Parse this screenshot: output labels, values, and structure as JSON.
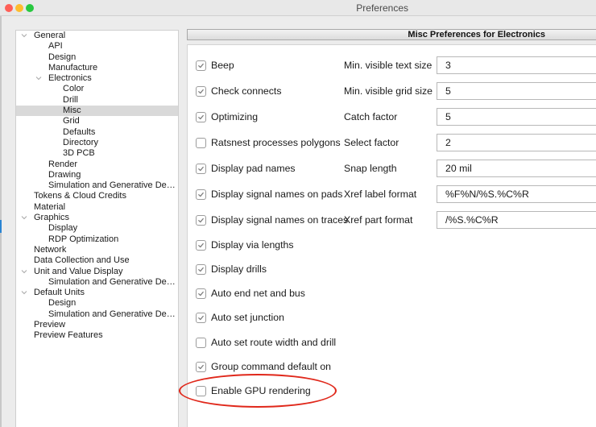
{
  "window": {
    "title": "Preferences"
  },
  "tree": {
    "items": [
      {
        "label": "General",
        "level": 0,
        "expanded": true,
        "selected": false
      },
      {
        "label": "API",
        "level": 1,
        "expanded": null,
        "selected": false
      },
      {
        "label": "Design",
        "level": 1,
        "expanded": null,
        "selected": false
      },
      {
        "label": "Manufacture",
        "level": 1,
        "expanded": null,
        "selected": false
      },
      {
        "label": "Electronics",
        "level": 1,
        "expanded": true,
        "selected": false
      },
      {
        "label": "Color",
        "level": 2,
        "expanded": null,
        "selected": false
      },
      {
        "label": "Drill",
        "level": 2,
        "expanded": null,
        "selected": false
      },
      {
        "label": "Misc",
        "level": 2,
        "expanded": null,
        "selected": true
      },
      {
        "label": "Grid",
        "level": 2,
        "expanded": null,
        "selected": false
      },
      {
        "label": "Defaults",
        "level": 2,
        "expanded": null,
        "selected": false
      },
      {
        "label": "Directory",
        "level": 2,
        "expanded": null,
        "selected": false
      },
      {
        "label": "3D PCB",
        "level": 2,
        "expanded": null,
        "selected": false
      },
      {
        "label": "Render",
        "level": 1,
        "expanded": null,
        "selected": false
      },
      {
        "label": "Drawing",
        "level": 1,
        "expanded": null,
        "selected": false
      },
      {
        "label": "Simulation and Generative Desi...",
        "level": 1,
        "expanded": null,
        "selected": false
      },
      {
        "label": "Tokens & Cloud Credits",
        "level": 0,
        "expanded": null,
        "selected": false
      },
      {
        "label": "Material",
        "level": 0,
        "expanded": null,
        "selected": false
      },
      {
        "label": "Graphics",
        "level": 0,
        "expanded": true,
        "selected": false
      },
      {
        "label": "Display",
        "level": 1,
        "expanded": null,
        "selected": false
      },
      {
        "label": "RDP Optimization",
        "level": 1,
        "expanded": null,
        "selected": false
      },
      {
        "label": "Network",
        "level": 0,
        "expanded": null,
        "selected": false
      },
      {
        "label": "Data Collection and Use",
        "level": 0,
        "expanded": null,
        "selected": false
      },
      {
        "label": "Unit and Value Display",
        "level": 0,
        "expanded": true,
        "selected": false
      },
      {
        "label": "Simulation and Generative Desi...",
        "level": 1,
        "expanded": null,
        "selected": false
      },
      {
        "label": "Default Units",
        "level": 0,
        "expanded": true,
        "selected": false
      },
      {
        "label": "Design",
        "level": 1,
        "expanded": null,
        "selected": false
      },
      {
        "label": "Simulation and Generative Desi...",
        "level": 1,
        "expanded": null,
        "selected": false
      },
      {
        "label": "Preview",
        "level": 0,
        "expanded": null,
        "selected": false
      },
      {
        "label": "Preview Features",
        "level": 0,
        "expanded": null,
        "selected": false
      }
    ]
  },
  "panel": {
    "title": "Misc Preferences for Electronics",
    "checkboxes": [
      {
        "label": "Beep",
        "checked": true
      },
      {
        "label": "Check connects",
        "checked": true
      },
      {
        "label": "Optimizing",
        "checked": true
      },
      {
        "label": "Ratsnest processes polygons",
        "checked": false
      },
      {
        "label": "Display pad names",
        "checked": true
      },
      {
        "label": "Display signal names on pads",
        "checked": true
      },
      {
        "label": "Display signal names on traces",
        "checked": true
      },
      {
        "label": "Display via lengths",
        "checked": true
      },
      {
        "label": "Display drills",
        "checked": true
      },
      {
        "label": "Auto end net and bus",
        "checked": true
      },
      {
        "label": "Auto set junction",
        "checked": true
      },
      {
        "label": "Auto set route width and drill",
        "checked": false
      },
      {
        "label": "Group command default on",
        "checked": true
      },
      {
        "label": "Enable GPU rendering",
        "checked": false
      }
    ],
    "fields": [
      {
        "label": "Min. visible text size",
        "value": "3"
      },
      {
        "label": "Min. visible grid size",
        "value": "5"
      },
      {
        "label": "Catch factor",
        "value": "5"
      },
      {
        "label": "Select factor",
        "value": "2"
      },
      {
        "label": "Snap length",
        "value": "20 mil"
      },
      {
        "label": "Xref label format",
        "value": "%F%N/%S.%C%R"
      },
      {
        "label": "Xref part format",
        "value": "/%S.%C%R"
      }
    ]
  },
  "annotation": {
    "highlighted_item": "Enable GPU rendering",
    "color": "#e0281b"
  }
}
